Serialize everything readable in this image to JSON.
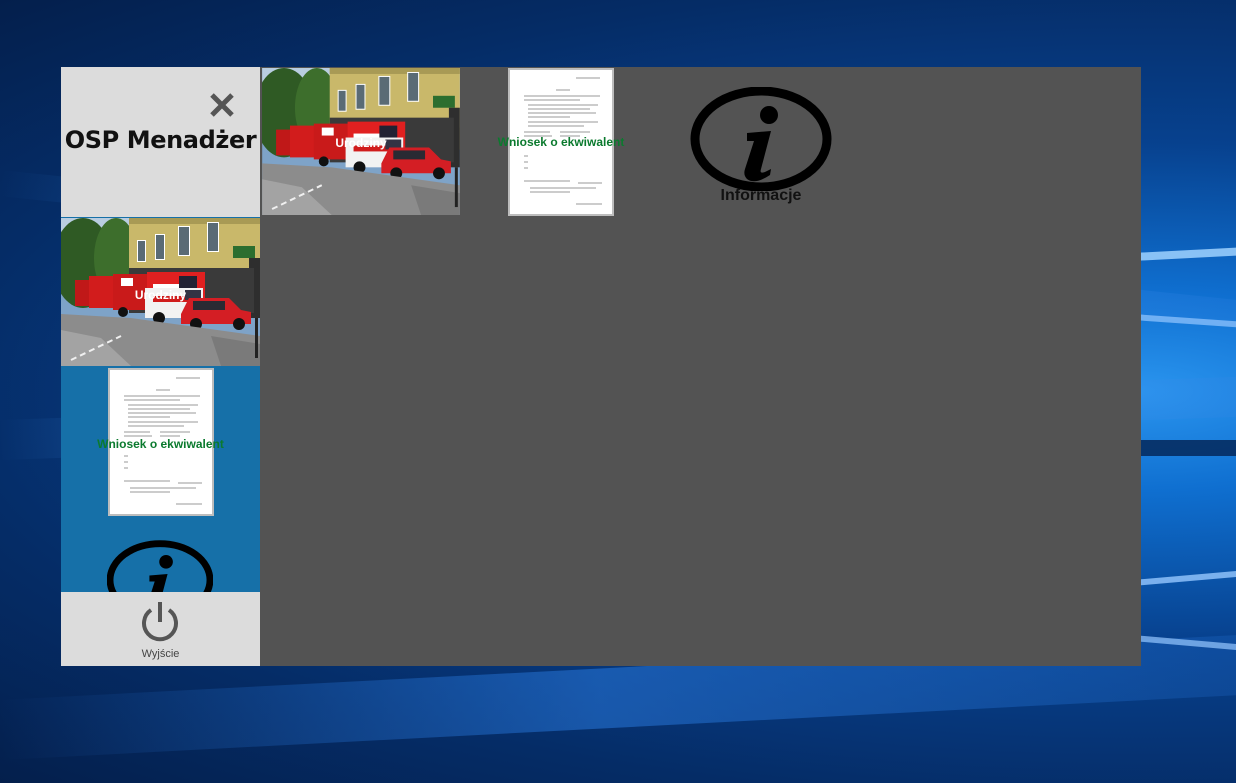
{
  "app": {
    "title": "OSP Menadżer"
  },
  "tiles": {
    "birthdays_label": "Urodziny",
    "request_label": "Wniosek o ekwiwalent",
    "info_label": "Informacje"
  },
  "footer": {
    "exit_label": "Wyjście"
  },
  "icons": {
    "close": "close-icon",
    "power": "power-icon",
    "info": "info-icon",
    "photo": "fire-station-photo",
    "document": "document-thumbnail"
  },
  "colors": {
    "pane_background": "#1670a8",
    "content_background": "#535353",
    "header_background": "#dcdcdc",
    "document_label": "#0b7a2e"
  }
}
